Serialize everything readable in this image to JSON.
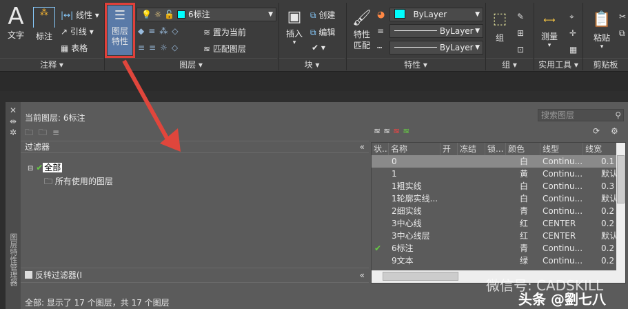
{
  "ribbon": {
    "annotate": {
      "text": "文字",
      "dimension": "标注",
      "linear": "线性",
      "leader": "引线",
      "table": "表格",
      "panel": "注释"
    },
    "layers": {
      "properties_button": "图层\n特性",
      "properties_line1": "图层",
      "properties_line2": "特性",
      "current_layer": "6标注",
      "current_color": "#00ffff",
      "set_current": "置为当前",
      "match_layer": "匹配图层",
      "panel": "图层"
    },
    "block": {
      "insert": "插入",
      "create": "创建",
      "edit": "编辑",
      "panel": "块"
    },
    "properties": {
      "match_line1": "特性",
      "match_line2": "匹配",
      "color": "ByLayer",
      "color_swatch": "#00ffff",
      "linetype": "ByLayer",
      "lineweight": "ByLayer",
      "panel": "特性"
    },
    "group": {
      "group": "组",
      "panel": "组"
    },
    "utilities": {
      "measure": "测量",
      "panel": "实用工具"
    },
    "clipboard": {
      "paste": "粘贴",
      "panel": "剪贴板"
    }
  },
  "palette": {
    "title": "图层特性管理器",
    "current_layer": "当前图层: 6标注",
    "search_placeholder": "搜索图层",
    "filters_header": "过滤器",
    "filter_all": "全部",
    "filter_used": "所有使用的图层",
    "invert_filter": "反转过滤器(I",
    "status": "全部: 显示了 17 个图层，共 17 个图层",
    "columns": [
      "状...",
      "名称",
      "开",
      "冻结",
      "锁...",
      "颜色",
      "线型",
      "线宽"
    ],
    "layers": [
      {
        "name": "0",
        "color_name": "白",
        "color": "#ffffff",
        "linetype": "Continu...",
        "lineweight": "0.1",
        "current": false,
        "selected": true
      },
      {
        "name": "1",
        "color_name": "黄",
        "color": "#ffff00",
        "linetype": "Continu...",
        "lineweight": "默认",
        "current": false
      },
      {
        "name": "1粗实线",
        "color_name": "白",
        "color": "#ffffff",
        "linetype": "Continu...",
        "lineweight": "0.3",
        "current": false,
        "thick": true
      },
      {
        "name": "1轮廓实线...",
        "color_name": "白",
        "color": "#ffffff",
        "linetype": "Continu...",
        "lineweight": "默认",
        "current": false
      },
      {
        "name": "2细实线",
        "color_name": "青",
        "color": "#00ffff",
        "linetype": "Continu...",
        "lineweight": "0.2",
        "current": false
      },
      {
        "name": "3中心线",
        "color_name": "红",
        "color": "#ff0000",
        "linetype": "CENTER",
        "lineweight": "0.2",
        "current": false
      },
      {
        "name": "3中心线层",
        "color_name": "红",
        "color": "#ff0000",
        "linetype": "CENTER",
        "lineweight": "默认",
        "current": false
      },
      {
        "name": "6标注",
        "color_name": "青",
        "color": "#00ffff",
        "linetype": "Continu...",
        "lineweight": "0.2",
        "current": true
      },
      {
        "name": "9文本",
        "color_name": "绿",
        "color": "#00ff00",
        "linetype": "Continu...",
        "lineweight": "0.2",
        "current": false
      }
    ]
  },
  "watermark": {
    "wechat": "微信号: CADSKILL",
    "toutiao": "头条 @劉七八"
  }
}
